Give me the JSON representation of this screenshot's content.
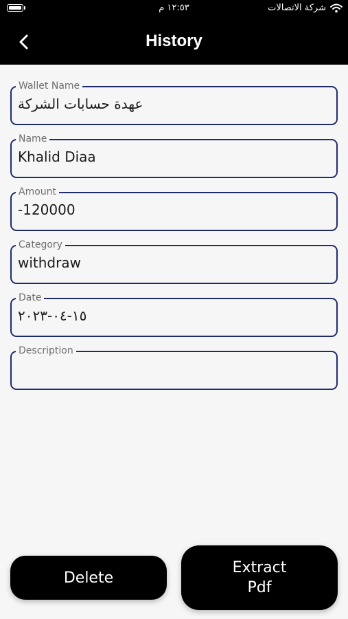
{
  "status_bar": {
    "time": "١٢:٥٣ م",
    "carrier": "شركة الاتصالات"
  },
  "header": {
    "title": "History",
    "back_icon": "chevron-left-icon"
  },
  "fields": {
    "wallet_name": {
      "label": "Wallet Name",
      "value": "عهدة حسابات الشركة"
    },
    "name": {
      "label": "Name",
      "value": "Khalid Diaa"
    },
    "amount": {
      "label": "Amount",
      "value": "-120000"
    },
    "category": {
      "label": "Category",
      "value": "withdraw"
    },
    "date": {
      "label": "Date",
      "value": "١٥-٠٤-٢٠٢٣"
    },
    "description": {
      "label": "Description",
      "value": ""
    }
  },
  "actions": {
    "delete_label": "Delete",
    "extract_line1": "Extract",
    "extract_line2": "Pdf"
  },
  "colors": {
    "header_bg": "#000000",
    "field_border": "#1f2b6b",
    "background": "#f6f6f6",
    "button_bg": "#000000"
  }
}
